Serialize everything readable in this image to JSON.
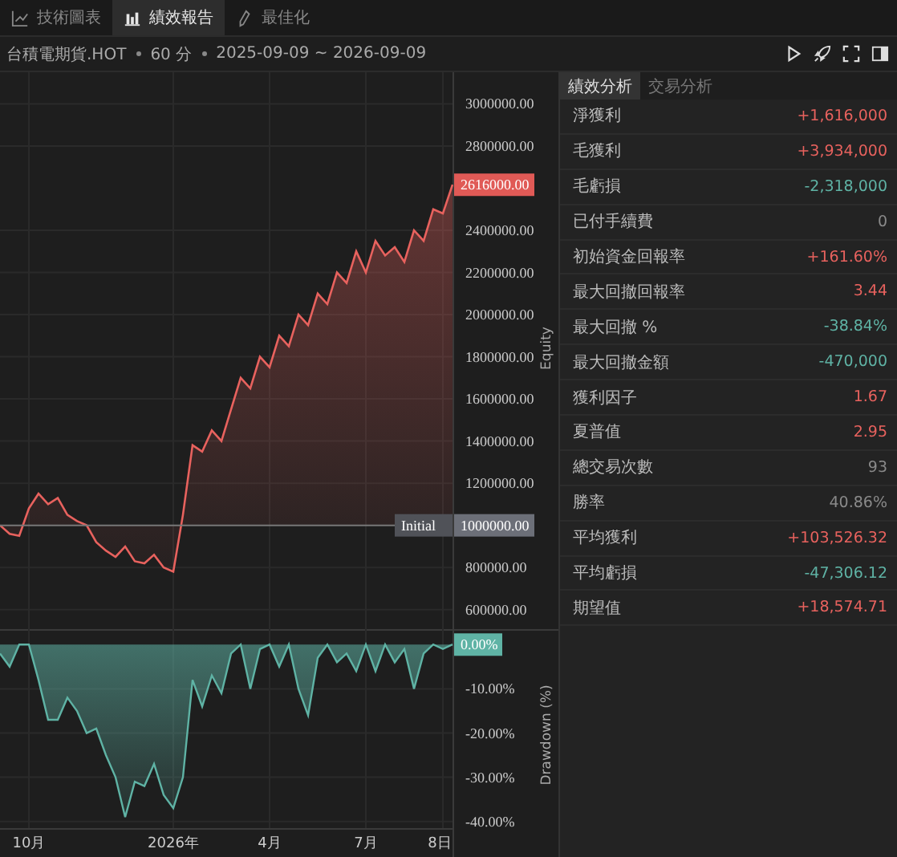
{
  "tabs": [
    {
      "label": "技術圖表",
      "selected": false
    },
    {
      "label": "績效報告",
      "selected": true
    },
    {
      "label": "最佳化",
      "selected": false
    }
  ],
  "info": {
    "symbol": "台積電期貨.HOT",
    "interval": "60 分",
    "range": "2025-09-09 ~ 2026-09-09"
  },
  "chart": {
    "equity": {
      "last_tag": "2616000.00",
      "initial_tag": "1000000.00",
      "chart_data": {
        "type": "area",
        "ylabel": "Equity",
        "grid": true,
        "series": [
          {
            "color": "#e8625e",
            "values": [
              1000000,
              960000,
              950000,
              1080000,
              1150000,
              1100000,
              1130000,
              1050000,
              1020000,
              1000000,
              920000,
              880000,
              850000,
              900000,
              830000,
              820000,
              860000,
              800000,
              780000,
              1050000,
              1380000,
              1350000,
              1450000,
              1400000,
              1550000,
              1700000,
              1650000,
              1800000,
              1750000,
              1900000,
              1850000,
              2000000,
              1950000,
              2100000,
              2050000,
              2200000,
              2150000,
              2300000,
              2200000,
              2350000,
              2280000,
              2320000,
              2250000,
              2400000,
              2350000,
              2500000,
              2480000,
              2616000
            ]
          }
        ],
        "ylim": [
          500000,
          3150000
        ],
        "ref_lines": [
          {
            "axis": "y",
            "value": 1000000,
            "label": "Initial"
          }
        ],
        "yticks": [
          {
            "value": 3000000,
            "label": "3000000.00"
          },
          {
            "value": 2800000,
            "label": "2800000.00"
          },
          {
            "value": 2400000,
            "label": "2400000.00"
          },
          {
            "value": 2200000,
            "label": "2200000.00"
          },
          {
            "value": 2000000,
            "label": "2000000.00"
          },
          {
            "value": 1800000,
            "label": "1800000.00"
          },
          {
            "value": 1600000,
            "label": "1600000.00"
          },
          {
            "value": 1400000,
            "label": "1400000.00"
          },
          {
            "value": 1200000,
            "label": "1200000.00"
          },
          {
            "value": 800000,
            "label": "800000.00"
          },
          {
            "value": 600000,
            "label": "600000.00"
          }
        ]
      }
    },
    "drawdown": {
      "last_tag": "0.00%",
      "chart_data": {
        "type": "area",
        "ylabel": "Drawdown (%)",
        "grid": true,
        "categories": [
          null,
          null,
          null,
          "10月",
          null,
          null,
          null,
          null,
          null,
          null,
          null,
          null,
          null,
          null,
          null,
          null,
          null,
          null,
          "2026年",
          null,
          null,
          null,
          null,
          null,
          null,
          null,
          null,
          null,
          "4月",
          null,
          null,
          null,
          null,
          null,
          null,
          null,
          null,
          null,
          "7月",
          null,
          null,
          null,
          null,
          null,
          null,
          null,
          "8日",
          null
        ],
        "series": [
          {
            "color": "#5fb3a5",
            "values": [
              -2,
              -5,
              0,
              0,
              -8,
              -17,
              -17,
              -12,
              -15,
              -20,
              -19,
              -25,
              -30,
              -39,
              -31,
              -32,
              -27,
              -34,
              -37,
              -30,
              -8,
              -14,
              -7,
              -11,
              -2,
              0,
              -10,
              -1,
              0,
              -5,
              0,
              -10,
              -16,
              -3,
              0,
              -4,
              -2,
              -6,
              0,
              -6,
              0,
              -4,
              -1,
              -10,
              -2,
              0,
              -1,
              0
            ]
          }
        ],
        "ylim": [
          -41.5,
          3.5
        ],
        "yticks": [
          {
            "value": -10,
            "label": "-10.00%"
          },
          {
            "value": -20,
            "label": "-20.00%"
          },
          {
            "value": -30,
            "label": "-30.00%"
          },
          {
            "value": -40,
            "label": "-40.00%"
          }
        ]
      }
    }
  },
  "panel_tabs": [
    {
      "label": "績效分析",
      "selected": true
    },
    {
      "label": "交易分析",
      "selected": false
    }
  ],
  "stats": [
    {
      "label": "淨獲利",
      "value": "+1,616,000",
      "color": "#e8625e"
    },
    {
      "label": "毛獲利",
      "value": "+3,934,000",
      "color": "#e8625e"
    },
    {
      "label": "毛虧損",
      "value": "-2,318,000",
      "color": "#5fb3a5"
    },
    {
      "label": "已付手續費",
      "value": "0",
      "color": "#8a8a8a"
    },
    {
      "label": "初始資金回報率",
      "value": "+161.60%",
      "color": "#e8625e"
    },
    {
      "label": "最大回撤回報率",
      "value": "3.44",
      "color": "#e8625e"
    },
    {
      "label": "最大回撤 %",
      "value": "-38.84%",
      "color": "#5fb3a5"
    },
    {
      "label": "最大回撤金額",
      "value": "-470,000",
      "color": "#5fb3a5"
    },
    {
      "label": "獲利因子",
      "value": "1.67",
      "color": "#e8625e"
    },
    {
      "label": "夏普值",
      "value": "2.95",
      "color": "#e8625e"
    },
    {
      "label": "總交易次數",
      "value": "93",
      "color": "#8a8a8a"
    },
    {
      "label": "勝率",
      "value": "40.86%",
      "color": "#8a8a8a"
    },
    {
      "label": "平均獲利",
      "value": "+103,526.32",
      "color": "#e8625e"
    },
    {
      "label": "平均虧損",
      "value": "-47,306.12",
      "color": "#5fb3a5"
    },
    {
      "label": "期望值",
      "value": "+18,574.71",
      "color": "#e8625e"
    }
  ]
}
